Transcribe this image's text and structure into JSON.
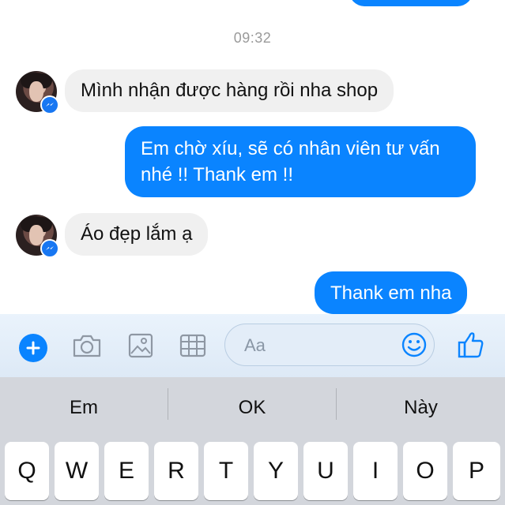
{
  "chat": {
    "timestamp": "09:32",
    "messages": [
      {
        "direction": "in",
        "text": "Mình nhận được hàng rồi nha shop"
      },
      {
        "direction": "out",
        "lines": [
          "Em chờ xíu, sẽ có nhân viên tư vấn",
          "nhé !! Thank em !!"
        ]
      },
      {
        "direction": "in",
        "text": "Áo đẹp lắm ạ"
      },
      {
        "direction": "out",
        "text": "Thank em nha"
      }
    ]
  },
  "composer": {
    "placeholder": "Aa",
    "icons": [
      "plus-icon",
      "camera-icon",
      "image-icon",
      "grid-icon",
      "emoji-icon",
      "thumbs-up-icon"
    ]
  },
  "keyboard": {
    "suggestions": [
      "Em",
      "OK",
      "Này"
    ],
    "row1": [
      "Q",
      "W",
      "E",
      "R",
      "T",
      "Y",
      "U",
      "I",
      "O",
      "P"
    ]
  },
  "colors": {
    "outgoing_bubble": "#0a84ff",
    "incoming_bubble": "#f0f0f0",
    "keyboard_bg": "#d3d6dc"
  }
}
